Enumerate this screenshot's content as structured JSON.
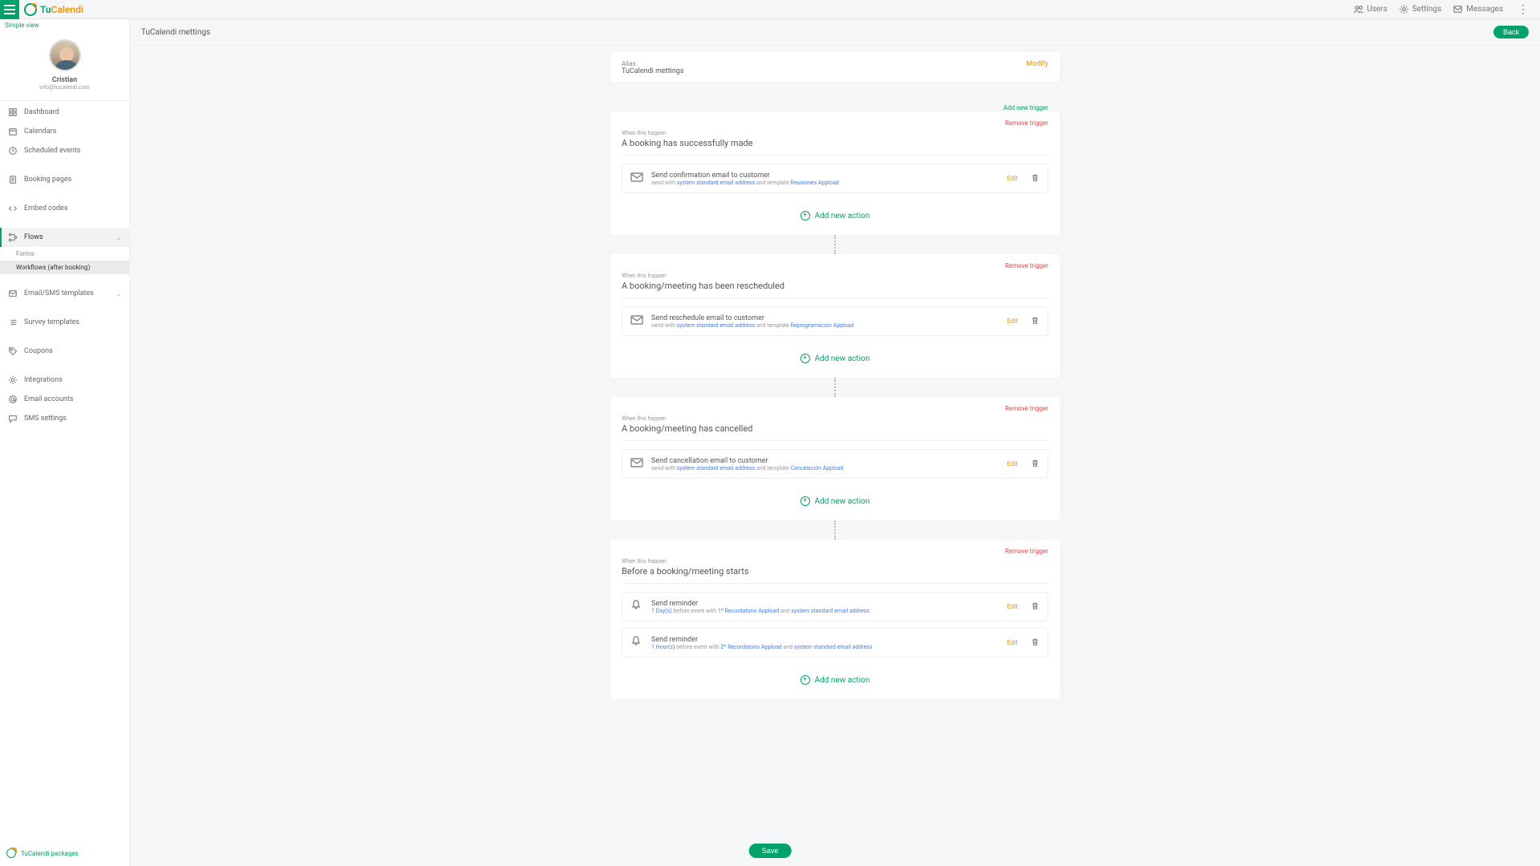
{
  "brand": {
    "tu": "Tu",
    "calendi": "Calendi"
  },
  "topbar": {
    "users": "Users",
    "settings": "Settings",
    "messages": "Messages"
  },
  "sidebar": {
    "simple_view": "Simple view",
    "profile": {
      "name": "Cristian",
      "email": "info@tucalendi.com"
    },
    "items": {
      "dashboard": "Dashboard",
      "calendars": "Calendars",
      "scheduled": "Scheduled events",
      "booking_pages": "Booking pages",
      "embed_codes": "Embed codes",
      "flows": "Flows",
      "forms": "Forms",
      "workflows": "Workflows (after booking)",
      "templates": "Email/SMS templates",
      "survey": "Survey templates",
      "coupons": "Coupons",
      "integrations": "Integrations",
      "email_accounts": "Email accounts",
      "sms_settings": "SMS settings"
    },
    "footer": "TuCalendi packages"
  },
  "page": {
    "title": "TuCalendi mettings",
    "back": "Back",
    "alias_label": "Alias:",
    "alias_value": "TuCalendi mettings",
    "modify": "Modify",
    "add_trigger": "Add new trigger",
    "when": "When this happen",
    "remove_trigger": "Remove trigger",
    "edit": "Edit",
    "add_action": "Add new action",
    "save": "Save"
  },
  "triggers": [
    {
      "title": "A booking has successfully made",
      "actions": [
        {
          "icon": "mail",
          "title": "Send confirmation email to customer",
          "desc_pre": "send with ",
          "link1": "system standard email address",
          "desc_mid": " and template ",
          "link2": "Reuniones Appload"
        }
      ]
    },
    {
      "title": "A booking/meeting has been rescheduled",
      "actions": [
        {
          "icon": "mail",
          "title": "Send reschedule email to customer",
          "desc_pre": "send with ",
          "link1": "system standard email address",
          "desc_mid": " and template ",
          "link2": "Reprogramación Appload"
        }
      ]
    },
    {
      "title": "A booking/meeting has cancelled",
      "actions": [
        {
          "icon": "mail",
          "title": "Send cancellation email to customer",
          "desc_pre": "send with ",
          "link1": "system standard email address",
          "desc_mid": " and template ",
          "link2": "Cancelación Appload"
        }
      ]
    },
    {
      "title": "Before a booking/meeting starts",
      "actions": [
        {
          "icon": "bell",
          "title": "Send reminder",
          "desc_pre": "",
          "link1": "1 Day(s)",
          "desc_mid": " before event with ",
          "link2": "1º Recordatorio Appload",
          "desc_mid2": " and ",
          "link3": "system standard email address"
        },
        {
          "icon": "bell",
          "title": "Send reminder",
          "desc_pre": "",
          "link1": "1 Hour(s)",
          "desc_mid": " before event with ",
          "link2": "2º Recordatorio Appload",
          "desc_mid2": " and ",
          "link3": "system standard email address"
        }
      ]
    }
  ]
}
